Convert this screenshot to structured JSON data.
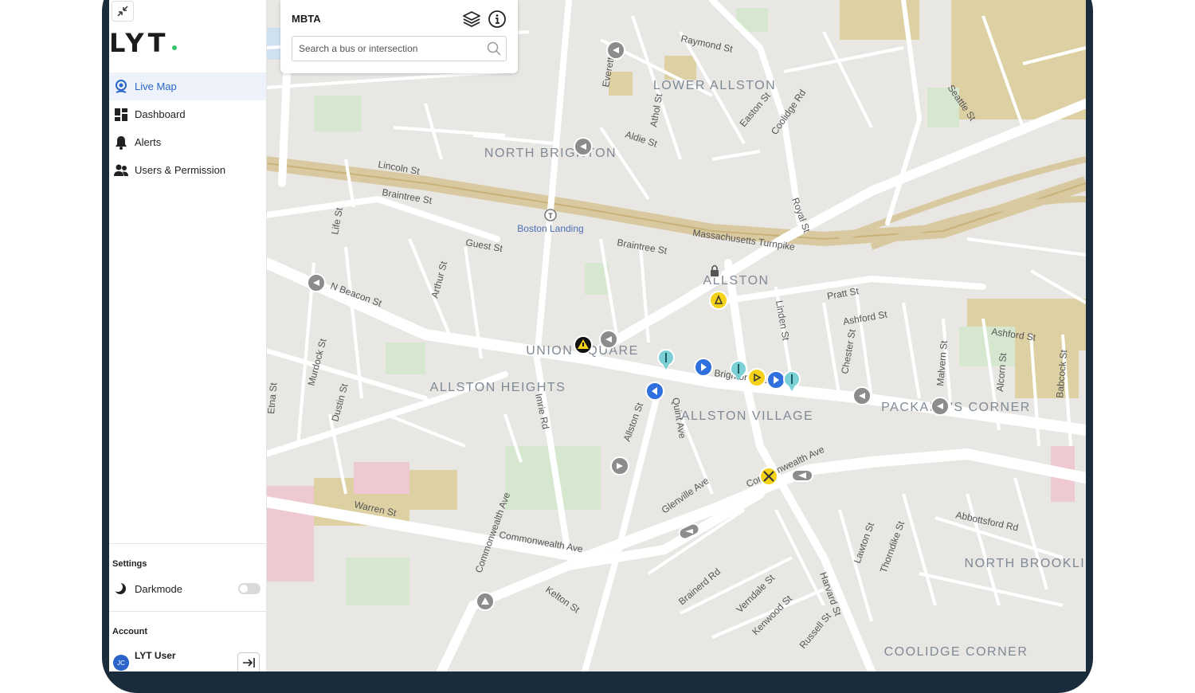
{
  "app": {
    "logo_text": "LYT"
  },
  "sidebar": {
    "items": [
      {
        "label": "Live Map",
        "icon": "location-pin-icon",
        "active": true
      },
      {
        "label": "Dashboard",
        "icon": "dashboard-grid-icon",
        "active": false
      },
      {
        "label": "Alerts",
        "icon": "bell-icon",
        "active": false
      },
      {
        "label": "Users & Permission",
        "icon": "users-icon",
        "active": false
      }
    ],
    "settings_title": "Settings",
    "darkmode_label": "Darkmode",
    "darkmode_on": false,
    "account_title": "Account",
    "user_name": "LYT User",
    "user_initials": "JC"
  },
  "panel": {
    "title": "MBTA",
    "search_placeholder": "Search a bus or intersection"
  },
  "map": {
    "street_labels": [
      "Raymond St",
      "Everett St",
      "Athol St",
      "Aldie St",
      "Easton St",
      "Coolidge Rd",
      "Seattle St",
      "Lincoln St",
      "Braintree St",
      "Life St",
      "Guest St",
      "Braintree St",
      "Massachusetts Turnpike",
      "Royal St",
      "Arthur St",
      "N Beacon St",
      "Pratt St",
      "Linden St",
      "Ashford St",
      "Ashford St",
      "Murdock St",
      "Chester St",
      "Malvern St",
      "Alcorn St",
      "Babcock St",
      "Etna St",
      "Dustin St",
      "Imrie Rd",
      "Allston St",
      "Quint Ave",
      "Commonwealth Ave",
      "Warren St",
      "Glenville Ave",
      "Commonwealth Ave",
      "Abbottsford Rd",
      "Lawton St",
      "Thorndike St",
      "Kelton St",
      "Brainerd Rd",
      "Verndale St",
      "Kenwood St",
      "Russell St",
      "Harvard St",
      "Brighton Ave",
      "Commonwealth Ave"
    ],
    "neighborhood_labels": [
      "LOWER ALLSTON",
      "NORTH BRIGHTON",
      "ALLSTON",
      "UNION SQUARE",
      "ALLSTON HEIGHTS",
      "ALLSTON VILLAGE",
      "PACKARD'S CORNER",
      "NORTH BROOKLINE",
      "COOLIDGE CORNER"
    ],
    "station_label": "Boston Landing",
    "colors": {
      "background": "#e9e7e4",
      "street": "#ffffff",
      "park": "#d5e8cf",
      "campus": "#ddd0a3",
      "hospital": "#efc9d1",
      "turnpike": "#d9c9a0",
      "bus_blue": "#2f6fde",
      "signal_yellow": "#f5d21a",
      "signal_gray": "#8c8c8c",
      "station_teal": "#7bd0d6"
    }
  }
}
